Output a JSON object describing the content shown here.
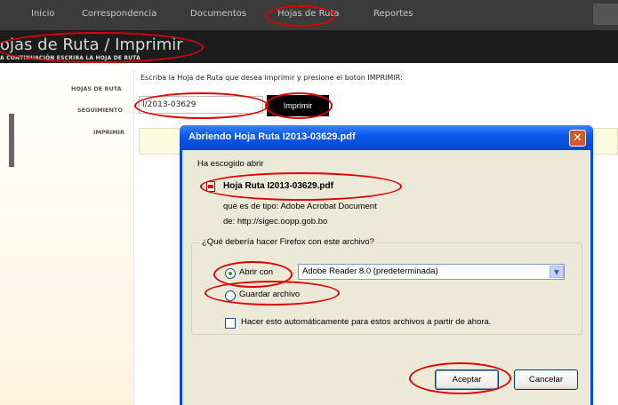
{
  "nav": {
    "items": [
      "Inicio",
      "Correspondencia",
      "Documentos",
      "Hojas de Ruta",
      "Reportes"
    ]
  },
  "header": {
    "title": "ojas de Ruta / Imprimir",
    "subtitle": "A CONTINUACIÓN ESCRIBA LA HOJA DE RUTA"
  },
  "form": {
    "label_hojas": "HOJAS DE RUTA",
    "label_seguimiento": "SEGUIMIENTO",
    "label_imprimir": "IMPRIMIR",
    "instruction": "Escriba la Hoja de Ruta que desea imprimir y presione el boton IMPRIMIR:",
    "tracking_value": "I/2013-03629",
    "print_button": "Imprimir"
  },
  "dialog": {
    "title": "Abriendo Hoja Ruta I2013-03629.pdf",
    "close_glyph": "✕",
    "chosen_text": "Ha escogido abrir",
    "file_name": "Hoja Ruta I2013-03629.pdf",
    "file_type": "que es de tipo:  Adobe Acrobat Document",
    "file_source": "de:  http://sigec.oopp.gob.bo",
    "question": "¿Qué debería hacer Firefox con este archivo?",
    "open_with_label": "Abrir con",
    "open_with_app": "Adobe Reader 8.0 (predeterminada)",
    "save_label": "Guardar archivo",
    "auto_label": "Hacer esto automáticamente para estos archivos a partir de ahora.",
    "ok_button": "Aceptar",
    "cancel_button": "Cancelar"
  },
  "colors": {
    "annotation": "#e00000",
    "titlebar": "#0a48dc",
    "dialog_bg": "#ece9d8"
  }
}
